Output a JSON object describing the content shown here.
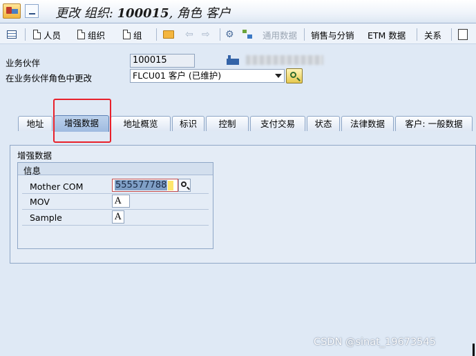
{
  "title": {
    "prefix": "更改 组织: ",
    "org_number": "100015",
    "suffix": ", 角色 客户"
  },
  "toolbar": {
    "persons": "人员",
    "organization": "组织",
    "group": "组",
    "general_data": "通用数据",
    "sales_distribution": "销售与分销",
    "etm_data": "ETM 数据",
    "relations": "关系"
  },
  "header": {
    "bp_label": "业务伙伴",
    "bp_value": "100015",
    "role_label": "在业务伙伴角色中更改",
    "role_value": "FLCU01 客户 (已维护)"
  },
  "tabs": [
    {
      "label": "地址",
      "active": false
    },
    {
      "label": "增强数据",
      "active": true
    },
    {
      "label": "地址概览",
      "active": false
    },
    {
      "label": "标识",
      "active": false
    },
    {
      "label": "控制",
      "active": false
    },
    {
      "label": "支付交易",
      "active": false
    },
    {
      "label": "状态",
      "active": false
    },
    {
      "label": "法律数据",
      "active": false
    },
    {
      "label": "客户: 一般数据",
      "active": false
    }
  ],
  "content": {
    "group_title": "增强数据",
    "info_title": "信息",
    "fields": [
      {
        "label": "Mother COM",
        "value": "555577788"
      },
      {
        "label": "MOV",
        "value": "A"
      },
      {
        "label": "Sample",
        "value": "A"
      }
    ]
  },
  "watermark": "CSDN @sinat_19673545",
  "colors": {
    "highlight_box": "#e8202a",
    "active_tab": "#9fbbe0",
    "background": "#dfe9f5"
  }
}
